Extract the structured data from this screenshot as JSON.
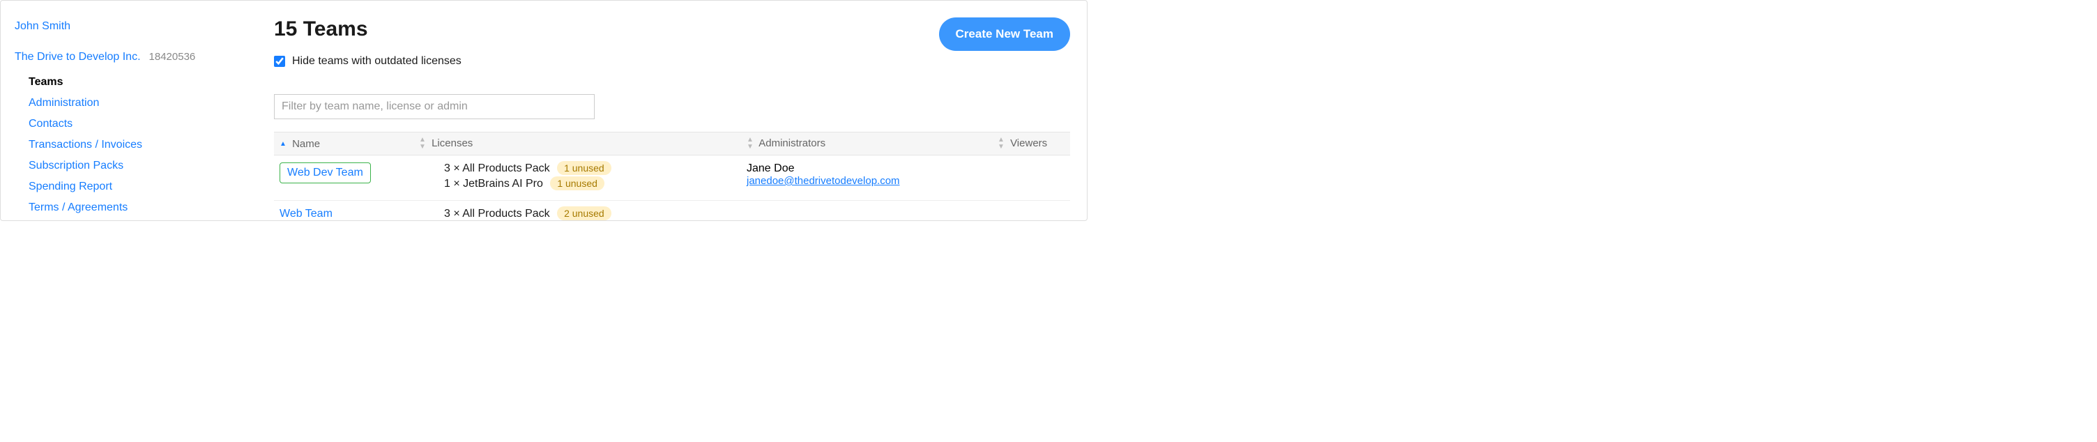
{
  "sidebar": {
    "user_name": "John Smith",
    "org_name": "The Drive to Develop Inc.",
    "org_id": "18420536",
    "nav": [
      {
        "label": "Teams",
        "active": true
      },
      {
        "label": "Administration",
        "active": false
      },
      {
        "label": "Contacts",
        "active": false
      },
      {
        "label": "Transactions / Invoices",
        "active": false
      },
      {
        "label": "Subscription Packs",
        "active": false
      },
      {
        "label": "Spending Report",
        "active": false
      },
      {
        "label": "Terms / Agreements",
        "active": false
      }
    ]
  },
  "header": {
    "title": "15 Teams",
    "create_button": "Create New Team"
  },
  "controls": {
    "hide_checkbox_label": "Hide teams with outdated licenses",
    "hide_checked": true,
    "filter_placeholder": "Filter by team name, license or admin"
  },
  "table": {
    "columns": {
      "name": "Name",
      "licenses": "Licenses",
      "administrators": "Administrators",
      "viewers": "Viewers"
    },
    "rows": [
      {
        "team": "Web Dev Team",
        "highlighted": true,
        "licenses": [
          {
            "text": "3 × All Products Pack",
            "badge": "1 unused"
          },
          {
            "text": "1 × JetBrains AI Pro",
            "badge": "1 unused"
          }
        ],
        "admin_name": "Jane Doe",
        "admin_email": "janedoe@thedrivetodevelop.com"
      },
      {
        "team": "Web Team",
        "highlighted": false,
        "licenses": [
          {
            "text": "3 × All Products Pack",
            "badge": "2 unused"
          }
        ],
        "admin_name": "",
        "admin_email": ""
      }
    ]
  }
}
